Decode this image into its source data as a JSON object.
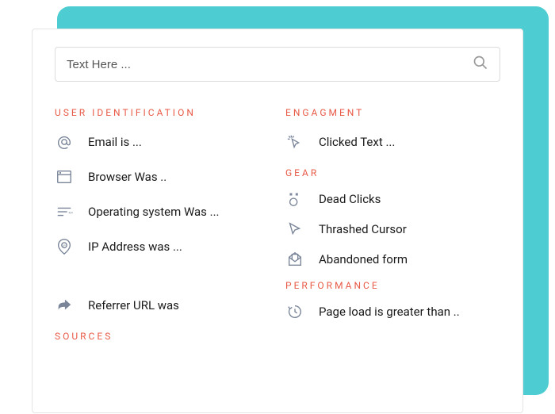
{
  "search": {
    "placeholder": "Text Here ..."
  },
  "colors": {
    "accent_teal": "#4dcdd1",
    "header_red": "#e85a47"
  },
  "left_column": {
    "sections": [
      {
        "header": "USER IDENTIFICATION",
        "items": [
          {
            "icon": "at-icon",
            "label": "Email is ..."
          },
          {
            "icon": "browser-icon",
            "label": "Browser Was .."
          },
          {
            "icon": "os-icon",
            "label": "Operating system Was ..."
          },
          {
            "icon": "ip-icon",
            "label": "IP Address was ..."
          }
        ]
      },
      {
        "header": "SOURCES",
        "items_above": [
          {
            "icon": "referrer-icon",
            "label": "Referrer URL was"
          }
        ]
      }
    ]
  },
  "right_column": {
    "sections": [
      {
        "header": "ENGAGMENT",
        "items": [
          {
            "icon": "click-icon",
            "label": "Clicked Text ..."
          }
        ]
      },
      {
        "header": "GEAR",
        "items": [
          {
            "icon": "dead-icon",
            "label": "Dead Clicks"
          },
          {
            "icon": "cursor-icon",
            "label": "Thrashed Cursor"
          },
          {
            "icon": "form-icon",
            "label": "Abandoned form"
          }
        ]
      },
      {
        "header": "PERFORMANCE",
        "items": [
          {
            "icon": "clock-icon",
            "label": "Page load is greater than .."
          }
        ]
      }
    ]
  }
}
